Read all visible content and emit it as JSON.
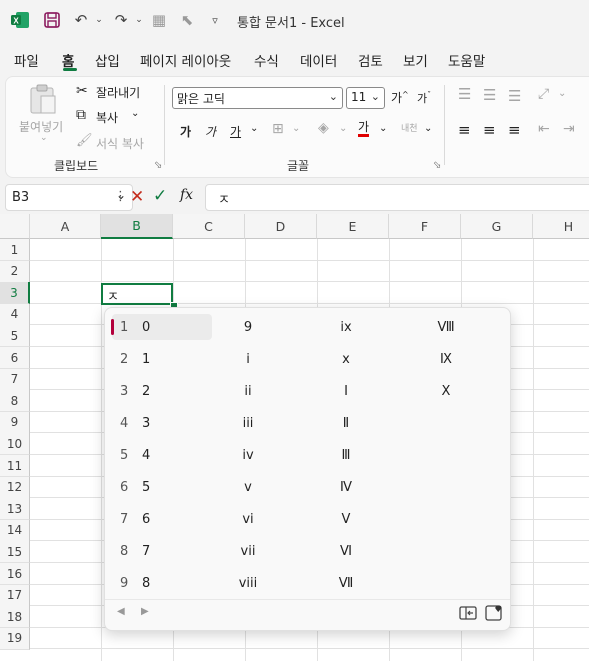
{
  "titlebar": {
    "title": "통합 문서1  -  Excel",
    "icons": [
      "excel-logo-icon",
      "save-icon",
      "undo-icon",
      "redo-icon",
      "form-icon",
      "select-icon",
      "customize-icon"
    ],
    "excel_color": "#107c41"
  },
  "menu": {
    "items": [
      "파일",
      "홈",
      "삽입",
      "페이지 레이아웃",
      "수식",
      "데이터",
      "검토",
      "보기",
      "도움말"
    ],
    "active": "홈"
  },
  "ribbon": {
    "clipboard": {
      "paste_label": "붙여넣기",
      "cut_label": "잘라내기",
      "copy_label": "복사",
      "format_painter_label": "서식 복사",
      "group_label": "클립보드"
    },
    "font": {
      "font_name": "맑은 고딕",
      "font_size": "11",
      "grow_label": "가",
      "shrink_label": "가",
      "bold_label": "가",
      "italic_label": "가",
      "underline_label": "가",
      "font_color_label": "가",
      "phonetic_label": "내천",
      "group_label": "글꼴",
      "font_color": "#e00000"
    }
  },
  "formula_bar": {
    "name_box": "B3",
    "fx_label": "fx",
    "value": "ㅈ"
  },
  "grid": {
    "columns": [
      "A",
      "B",
      "C",
      "D",
      "E",
      "F",
      "G",
      "H"
    ],
    "rows": [
      "1",
      "2",
      "3",
      "4",
      "5",
      "6",
      "7",
      "8",
      "9",
      "10",
      "11",
      "12",
      "13",
      "14",
      "15",
      "16",
      "17",
      "18",
      "19"
    ],
    "selected_col": "B",
    "selected_row": "3",
    "active_cell_value": "ㅈ"
  },
  "ime": {
    "columns": [
      [
        {
          "idx": "1",
          "val": "0"
        },
        {
          "idx": "2",
          "val": "1"
        },
        {
          "idx": "3",
          "val": "2"
        },
        {
          "idx": "4",
          "val": "3"
        },
        {
          "idx": "5",
          "val": "4"
        },
        {
          "idx": "6",
          "val": "5"
        },
        {
          "idx": "7",
          "val": "6"
        },
        {
          "idx": "8",
          "val": "7"
        },
        {
          "idx": "9",
          "val": "8"
        }
      ],
      [
        "9",
        "i",
        "ii",
        "iii",
        "iv",
        "v",
        "vi",
        "vii",
        "viii"
      ],
      [
        "ix",
        "x",
        "Ⅰ",
        "Ⅱ",
        "Ⅲ",
        "Ⅳ",
        "Ⅴ",
        "Ⅵ",
        "Ⅶ"
      ],
      [
        "Ⅷ",
        "Ⅸ",
        "Ⅹ"
      ]
    ],
    "selected_index": 0,
    "accent_color": "#b3003b"
  }
}
